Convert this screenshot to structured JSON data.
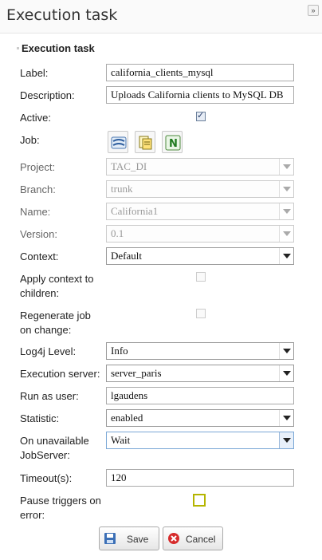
{
  "window": {
    "title": "Execution task",
    "collapse_glyph": "»"
  },
  "section": {
    "title": "Execution task"
  },
  "fields": {
    "label": {
      "label": "Label:",
      "value": "california_clients_mysql"
    },
    "description": {
      "label": "Description:",
      "value": "Uploads California clients to MySQL DB"
    },
    "active": {
      "label": "Active:",
      "checked": true
    },
    "job": {
      "label": "Job:",
      "buttons": [
        "job-browse-icon",
        "job-list-icon",
        "job-new-icon"
      ],
      "new_glyph": "N"
    },
    "project": {
      "label": "Project:",
      "value": "TAC_DI",
      "disabled": true
    },
    "branch": {
      "label": "Branch:",
      "value": "trunk",
      "disabled": true
    },
    "name": {
      "label": "Name:",
      "value": "California1",
      "disabled": true
    },
    "version": {
      "label": "Version:",
      "value": "0.1",
      "disabled": true
    },
    "context": {
      "label": "Context:",
      "value": "Default"
    },
    "apply_context": {
      "label_line1": "Apply context to",
      "label_line2": "children:",
      "checked": false,
      "disabled": true
    },
    "regenerate_job": {
      "label_line1": "Regenerate job",
      "label_line2": "on change:",
      "checked": false,
      "disabled": true
    },
    "log4j_level": {
      "label": "Log4j Level:",
      "value": "Info"
    },
    "execution_server": {
      "label": "Execution server:",
      "value": "server_paris"
    },
    "run_as_user": {
      "label": "Run as user:",
      "value": "lgaudens"
    },
    "statistic": {
      "label": "Statistic:",
      "value": "enabled"
    },
    "unavailable_jobserver": {
      "label_line1": "On unavailable",
      "label_line2": "JobServer:",
      "value": "Wait"
    },
    "timeout": {
      "label": "Timeout(s):",
      "value": "120"
    },
    "pause_triggers": {
      "label_line1": "Pause triggers on",
      "label_line2": "error:",
      "checked": false
    }
  },
  "buttons": {
    "save": "Save",
    "cancel": "Cancel"
  },
  "colors": {
    "save_icon": "#3b6fb6",
    "cancel_icon": "#d62b2b",
    "checkbox_highlight": "#b5b500"
  }
}
